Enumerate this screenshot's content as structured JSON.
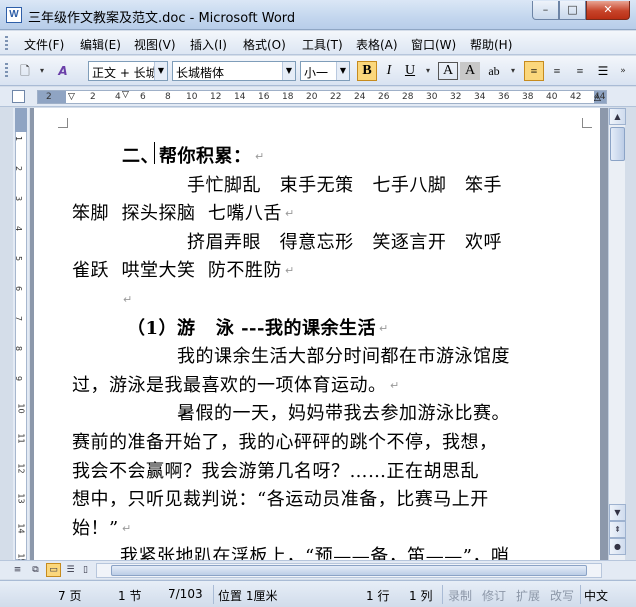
{
  "window": {
    "title": "三年级作文教案及范文.doc - Microsoft Word",
    "app_icon": "W",
    "minimize": "–",
    "maximize": "□",
    "close": "✕"
  },
  "menu": {
    "items": [
      "文件(F)",
      "编辑(E)",
      "视图(V)",
      "插入(I)",
      "格式(O)",
      "工具(T)",
      "表格(A)",
      "窗口(W)",
      "帮助(H)"
    ]
  },
  "toolbar": {
    "style_value": "正文 + 长城",
    "font_value": "长城楷体",
    "size_value": "小一",
    "bold_label": "B",
    "italic_label": "I",
    "underline_label": "U",
    "char_border_label": "A",
    "char_shade_label": "A",
    "highlight_label": "ab"
  },
  "ruler": {
    "ticks": [
      "2",
      "2",
      "4",
      "6",
      "8",
      "10",
      "12",
      "14",
      "16",
      "18",
      "20",
      "22",
      "24",
      "26",
      "28",
      "30",
      "32",
      "34",
      "36",
      "38",
      "40",
      "42",
      "44"
    ]
  },
  "vruler": {
    "numbers": [
      "1",
      "2",
      "3",
      "4",
      "5",
      "6",
      "7",
      "8",
      "9",
      "10",
      "11",
      "12",
      "13",
      "14",
      "15"
    ]
  },
  "document": {
    "lines": [
      {
        "text": "二、帮你积累：",
        "bold": true,
        "indent": 50,
        "mark": "↵"
      },
      {
        "text": "手忙脚乱   束手无策   七手八脚   笨手",
        "bold": false,
        "indent": 115,
        "mark": ""
      },
      {
        "text": "笨脚  探头探脑  七嘴八舌",
        "bold": false,
        "indent": 0,
        "mark": "↵"
      },
      {
        "text": "挤眉弄眼   得意忘形   笑逐言开   欢呼",
        "bold": false,
        "indent": 115,
        "mark": ""
      },
      {
        "text": "雀跃  哄堂大笑  防不胜防",
        "bold": false,
        "indent": 0,
        "mark": "↵"
      },
      {
        "text": "",
        "bold": false,
        "indent": 48,
        "mark": "↵"
      },
      {
        "text": "（1）游   泳 ---我的课余生活",
        "bold": true,
        "indent": 55,
        "mark": "↵"
      },
      {
        "text": "我的课余生活大部分时间都在市游泳馆度",
        "bold": false,
        "indent": 105,
        "mark": ""
      },
      {
        "text": "过，游泳是我最喜欢的一项体育运动。",
        "bold": false,
        "indent": 0,
        "mark": "↵"
      },
      {
        "text": "暑假的一天，妈妈带我去参加游泳比赛。",
        "bold": false,
        "indent": 105,
        "mark": ""
      },
      {
        "text": "赛前的准备开始了，我的心砰砰的跳个不停，我想，",
        "bold": false,
        "indent": 0,
        "mark": ""
      },
      {
        "text": "我会不会赢啊？我会游第几名呀？……正在胡思乱",
        "bold": false,
        "indent": 0,
        "mark": ""
      },
      {
        "text": "想中，只听见裁判说：“各运动员准备，比赛马上开",
        "bold": false,
        "indent": 0,
        "mark": ""
      },
      {
        "text": "始！”",
        "bold": false,
        "indent": 0,
        "mark": "↵"
      },
      {
        "text": "我紧张地趴在浮板上，“预——备，笛——”，哨",
        "bold": false,
        "indent": 48,
        "mark": ""
      }
    ]
  },
  "status": {
    "page": "7 页",
    "section": "1 节",
    "page_of": "7/103",
    "position": "位置 1厘米",
    "line": "1 行",
    "column": "1 列",
    "rec": "录制",
    "trk": "修订",
    "ext": "扩展",
    "ovr": "改写",
    "lang": "中文"
  }
}
